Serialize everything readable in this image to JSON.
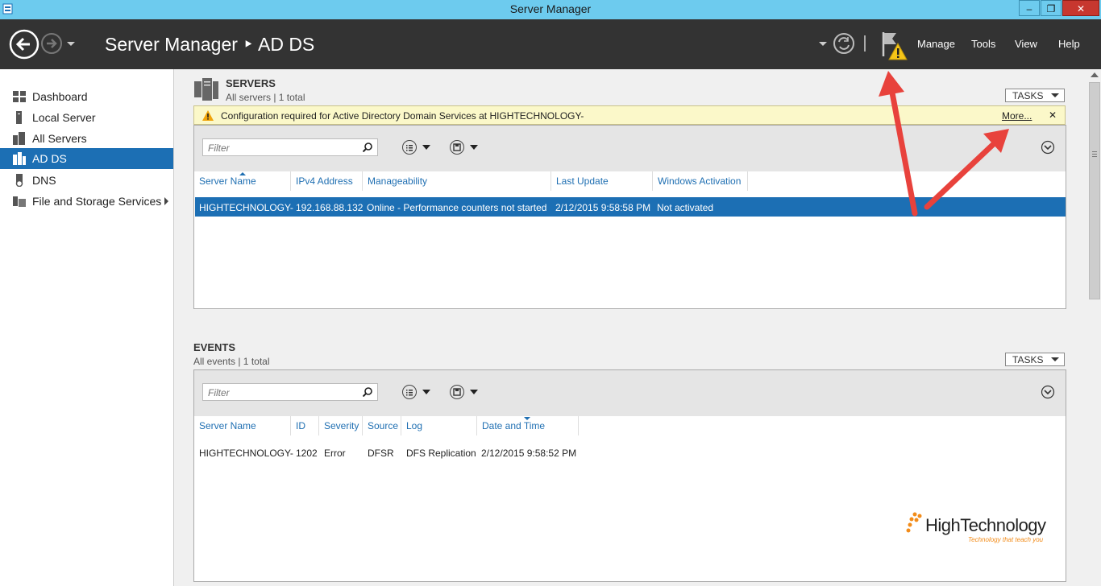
{
  "window": {
    "title": "Server Manager",
    "min": "‒",
    "restore": "❐",
    "close": "✕"
  },
  "header": {
    "breadcrumb": "Server Manager ‣ AD DS",
    "menus": [
      "Manage",
      "Tools",
      "View",
      "Help"
    ]
  },
  "sidebar": {
    "items": [
      {
        "label": "Dashboard",
        "icon": "dashboard-icon"
      },
      {
        "label": "Local Server",
        "icon": "server-icon"
      },
      {
        "label": "All Servers",
        "icon": "servers-icon"
      },
      {
        "label": "AD DS",
        "icon": "adds-icon",
        "selected": true
      },
      {
        "label": "DNS",
        "icon": "dns-icon"
      },
      {
        "label": "File and Storage Services",
        "icon": "storage-icon",
        "has_submenu": true
      }
    ]
  },
  "servers": {
    "title": "SERVERS",
    "subtitle": "All servers | 1 total",
    "tasks": "TASKS",
    "banner": {
      "message": "Configuration required for Active Directory Domain Services at HIGHTECHNOLOGY-",
      "more": "More...",
      "close": "✕"
    },
    "filter_placeholder": "Filter",
    "columns": [
      "Server Name",
      "IPv4 Address",
      "Manageability",
      "Last Update",
      "Windows Activation"
    ],
    "rows": [
      [
        "HIGHTECHNOLOGY-",
        "192.168.88.132",
        "Online - Performance counters not started",
        "2/12/2015 9:58:58 PM",
        "Not activated"
      ]
    ]
  },
  "events": {
    "title": "EVENTS",
    "subtitle": "All events | 1 total",
    "tasks": "TASKS",
    "filter_placeholder": "Filter",
    "columns": [
      "Server Name",
      "ID",
      "Severity",
      "Source",
      "Log",
      "Date and Time"
    ],
    "rows": [
      [
        "HIGHTECHNOLOGY-",
        "1202",
        "Error",
        "DFSR",
        "DFS Replication",
        "2/12/2015 9:58:52 PM"
      ]
    ]
  },
  "watermark": {
    "brand": "HighTechnology",
    "tagline": "Technology that teach you"
  },
  "colors": {
    "accent": "#1c6fb4",
    "header": "#333333",
    "titlebar": "#6dcbee",
    "banner": "#fbf8c9",
    "annotation": "#e8423c"
  }
}
